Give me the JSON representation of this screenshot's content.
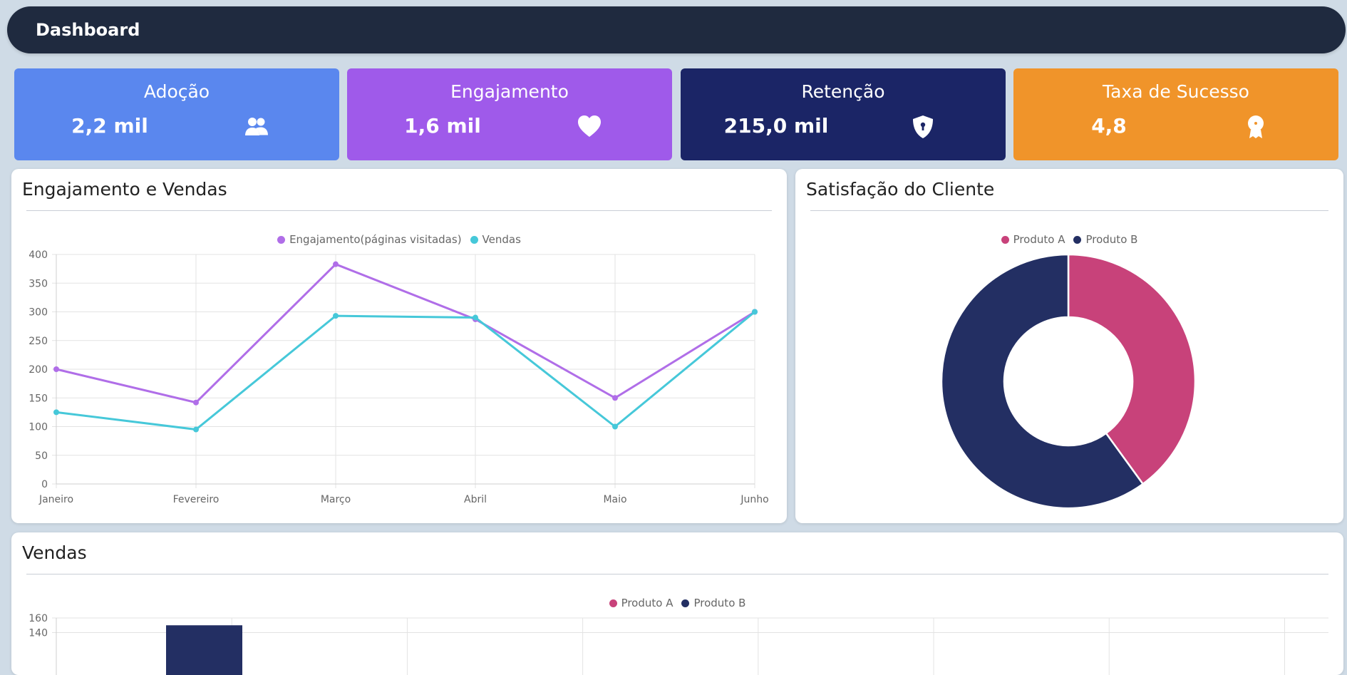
{
  "header": {
    "title": "Dashboard"
  },
  "kpis": [
    {
      "label": "Adoção",
      "value": "2,2 mil",
      "icon": "users-icon",
      "color": "#5a87ee"
    },
    {
      "label": "Engajamento",
      "value": "1,6 mil",
      "icon": "heart-icon",
      "color": "#9f5aea"
    },
    {
      "label": "Retenção",
      "value": "215,0 mil",
      "icon": "shield-lock-icon",
      "color": "#1b2566"
    },
    {
      "label": "Taxa de Sucesso",
      "value": "4,8",
      "icon": "award-icon",
      "color": "#f0942a"
    }
  ],
  "line_panel": {
    "title": "Engajamento e Vendas"
  },
  "pie_panel": {
    "title": "Satisfação do Cliente"
  },
  "bar_panel": {
    "title": "Vendas"
  },
  "chart_data": [
    {
      "type": "line",
      "categories": [
        "Janeiro",
        "Fevereiro",
        "Março",
        "Abril",
        "Maio",
        "Junho"
      ],
      "series": [
        {
          "name": "Engajamento(páginas visitadas)",
          "values": [
            200,
            142,
            383,
            287,
            150,
            300
          ],
          "color": "#b06ee8"
        },
        {
          "name": "Vendas",
          "values": [
            125,
            95,
            293,
            290,
            100,
            300
          ],
          "color": "#46c8d9"
        }
      ],
      "ylim": [
        0,
        400
      ],
      "yticks": [
        0,
        50,
        100,
        150,
        200,
        250,
        300,
        350,
        400
      ],
      "grid": true,
      "legend": "top-center"
    },
    {
      "type": "pie",
      "donut": true,
      "labels": [
        "Produto A",
        "Produto B"
      ],
      "values": [
        40,
        60
      ],
      "colors": [
        "#c8427a",
        "#232f63"
      ],
      "legend": "top-center"
    },
    {
      "type": "bar",
      "legend_labels": [
        "Produto A",
        "Produto B"
      ],
      "colors": [
        "#c8427a",
        "#232f63"
      ],
      "visible_yticks": [
        "160",
        "140"
      ],
      "ylim": [
        0,
        160
      ],
      "visible_bar": {
        "series": "Produto B",
        "approx_value": 150
      },
      "legend": "top-center"
    }
  ]
}
